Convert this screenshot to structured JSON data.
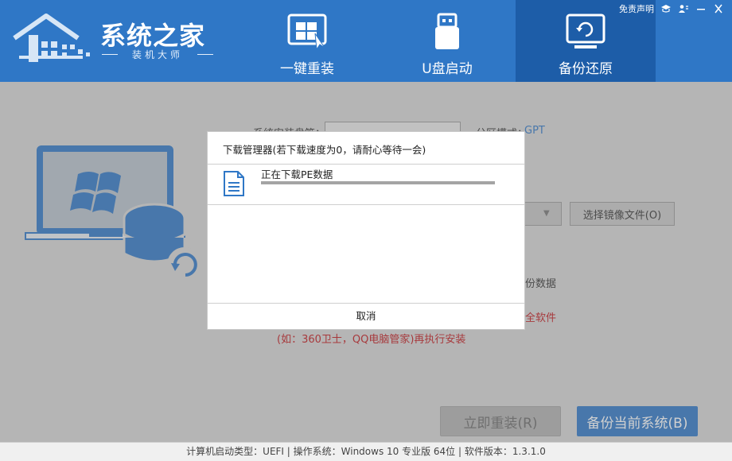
{
  "app": {
    "brand_title": "系统之家",
    "brand_subtitle": "装机大师"
  },
  "top_links": {
    "disclaimer": "免责声明"
  },
  "nav_tabs": [
    {
      "label": "一键重装",
      "icon": "windows-install-icon"
    },
    {
      "label": "U盘启动",
      "icon": "usb-drive-icon"
    },
    {
      "label": "备份还原",
      "icon": "backup-restore-icon",
      "active": true
    }
  ],
  "main": {
    "install_disk_label": "系统安装盘符：",
    "partition_label": "分区模式：",
    "partition_value": "GPT",
    "choose_image_button": "选择镜像文件(O)",
    "backup_data_partial": "份数据",
    "warning_partial": "全软件",
    "warning_line": "(如：360卫士，QQ电脑管家)再执行安装",
    "reinstall_button": "立即重装(R)",
    "backup_button": "备份当前系统(B)"
  },
  "dialog": {
    "title": "下载管理器(若下载速度为0，请耐心等待一会)",
    "download_text": "正在下载PE数据",
    "progress": 1.0,
    "cancel_button": "取消"
  },
  "status_bar": {
    "text": "计算机启动类型：UEFI | 操作系统：Windows 10 专业版 64位 | 软件版本：1.3.1.0"
  },
  "colors": {
    "header_blue": "#2f77c6",
    "active_tab": "#1d5da8",
    "warning_red": "#c0171c"
  }
}
